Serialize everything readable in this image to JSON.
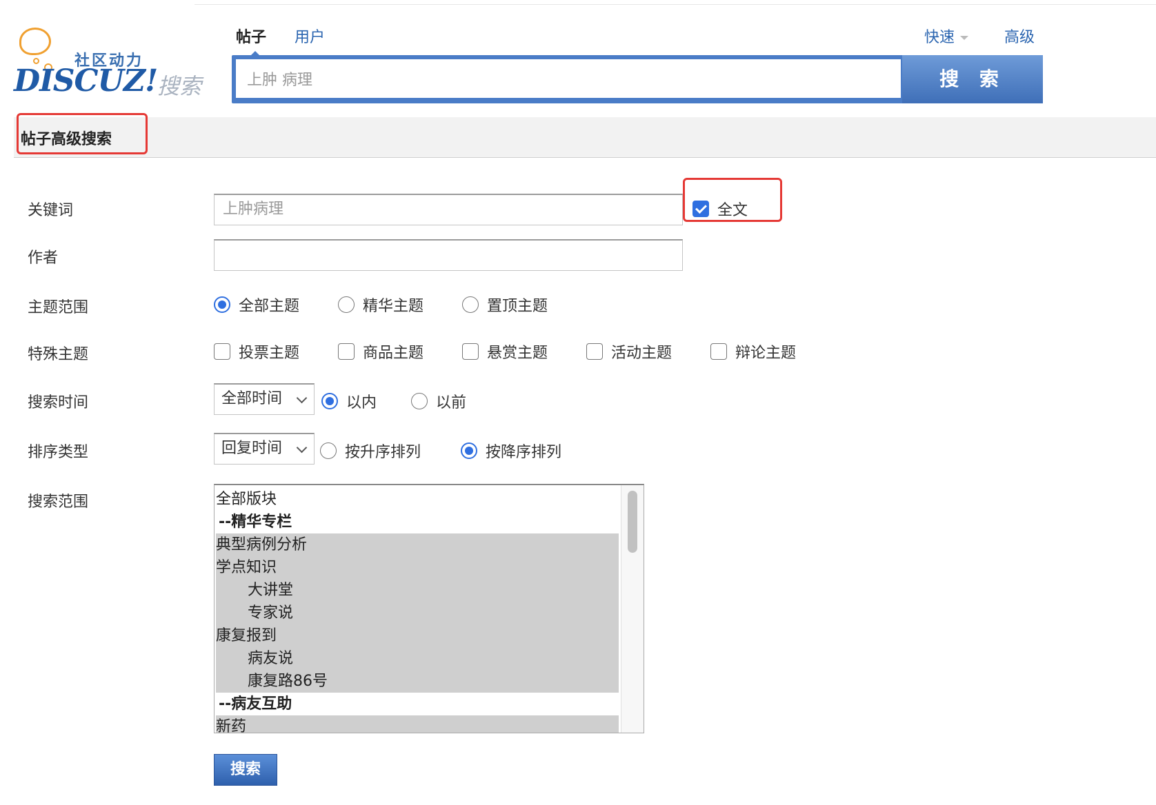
{
  "logo": {
    "cn_text": "社区动力",
    "brand": "DISCUZ!",
    "sub": "搜索"
  },
  "search_tabs": [
    {
      "label": "帖子",
      "active": true
    },
    {
      "label": "用户",
      "active": false
    }
  ],
  "header_links": {
    "quick": "快速",
    "advanced": "高级"
  },
  "search_bar": {
    "value": "上肿 病理",
    "button": "搜 索"
  },
  "section_title": "帖子高级搜索",
  "form": {
    "keyword_label": "关键词",
    "keyword_value": "上肿病理",
    "fulltext_label": "全文",
    "fulltext_checked": true,
    "author_label": "作者",
    "author_value": "",
    "topic_scope_label": "主题范围",
    "topic_scope_options": [
      {
        "label": "全部主题",
        "checked": true
      },
      {
        "label": "精华主题",
        "checked": false
      },
      {
        "label": "置顶主题",
        "checked": false
      }
    ],
    "special_label": "特殊主题",
    "special_options": [
      {
        "label": "投票主题",
        "checked": false
      },
      {
        "label": "商品主题",
        "checked": false
      },
      {
        "label": "悬赏主题",
        "checked": false
      },
      {
        "label": "活动主题",
        "checked": false
      },
      {
        "label": "辩论主题",
        "checked": false
      }
    ],
    "time_label": "搜索时间",
    "time_select": "全部时间",
    "time_options": [
      {
        "label": "以内",
        "checked": true
      },
      {
        "label": "以前",
        "checked": false
      }
    ],
    "order_label": "排序类型",
    "order_select": "回复时间",
    "order_options": [
      {
        "label": "按升序排列",
        "checked": false
      },
      {
        "label": "按降序排列",
        "checked": true
      }
    ],
    "range_label": "搜索范围",
    "range_items": [
      {
        "label": "全部版块",
        "type": "item",
        "selected": false
      },
      {
        "label": "--精华专栏",
        "type": "group",
        "selected": false
      },
      {
        "label": "典型病例分析",
        "type": "item",
        "selected": true
      },
      {
        "label": "学点知识",
        "type": "item",
        "selected": true
      },
      {
        "label": "大讲堂",
        "type": "indent",
        "selected": true
      },
      {
        "label": "专家说",
        "type": "indent",
        "selected": true
      },
      {
        "label": "康复报到",
        "type": "item",
        "selected": true
      },
      {
        "label": "病友说",
        "type": "indent",
        "selected": true
      },
      {
        "label": "康复路86号",
        "type": "indent",
        "selected": true
      },
      {
        "label": "--病友互助",
        "type": "group",
        "selected": false
      },
      {
        "label": "新药",
        "type": "item",
        "selected": true
      }
    ],
    "submit": "搜索"
  }
}
